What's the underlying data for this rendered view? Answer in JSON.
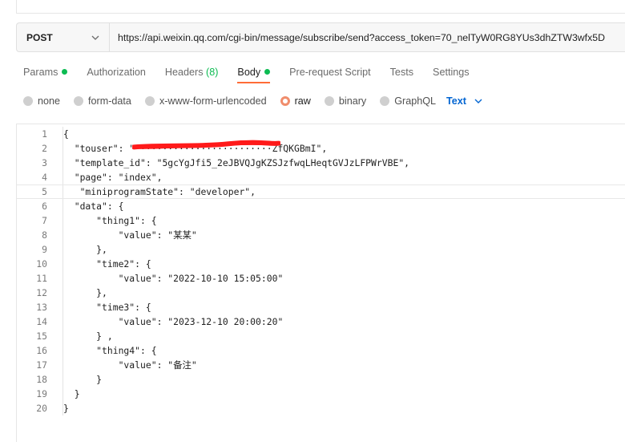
{
  "request": {
    "method": "POST",
    "url": "https://api.weixin.qq.com/cgi-bin/message/subscribe/send?access_token=70_nelTyW0RG8YUs3dhZTW3wfx5D"
  },
  "tabs": [
    {
      "label": "Params",
      "dot": true
    },
    {
      "label": "Authorization"
    },
    {
      "label": "Headers",
      "count": "(8)"
    },
    {
      "label": "Body",
      "dot": true,
      "active": true
    },
    {
      "label": "Pre-request Script"
    },
    {
      "label": "Tests"
    },
    {
      "label": "Settings"
    }
  ],
  "body_types": {
    "options": [
      "none",
      "form-data",
      "x-www-form-urlencoded",
      "raw",
      "binary",
      "GraphQL"
    ],
    "selected": "raw",
    "format": "Text"
  },
  "editor": {
    "lines": [
      "{",
      "  \"touser\": \"·························ZfQKGBmI\",",
      "  \"template_id\": \"5gcYgJfi5_2eJBVQJgKZSJzfwqLHeqtGVJzLFPWrVBE\",",
      "  \"page\": \"index\",",
      "   \"miniprogramState\": \"developer\",",
      "  \"data\": {",
      "      \"thing1\": {",
      "          \"value\": \"某某\"",
      "      },",
      "      \"time2\": {",
      "          \"value\": \"2022-10-10 15:05:00\"",
      "      },",
      "      \"time3\": {",
      "          \"value\": \"2023-12-10 20:00:20\"",
      "      } ,",
      "      \"thing4\": {",
      "          \"value\": \"备注\"",
      "      }",
      "  }",
      "}"
    ],
    "line_numbers": [
      "1",
      "2",
      "3",
      "4",
      "5",
      "6",
      "7",
      "8",
      "9",
      "10",
      "11",
      "12",
      "13",
      "14",
      "15",
      "16",
      "17",
      "18",
      "19",
      "20"
    ],
    "current_line": 5
  },
  "colors": {
    "accent": "#ff6c37",
    "status_dot": "#0cbb52",
    "link": "#0265d2",
    "redaction": "#ff1a1a"
  }
}
